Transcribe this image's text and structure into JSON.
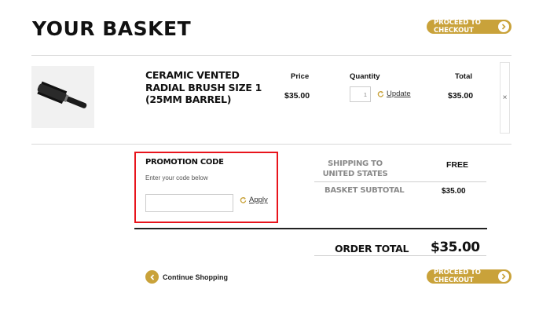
{
  "page": {
    "title": "YOUR BASKET"
  },
  "checkout": {
    "label": "PROCEED TO CHECKOUT"
  },
  "columns": {
    "price": "Price",
    "quantity": "Quantity",
    "total": "Total"
  },
  "item": {
    "name": "CERAMIC VENTED RADIAL BRUSH SIZE 1 (25MM BARREL)",
    "price": "$35.00",
    "quantity": "1",
    "update_label": "Update",
    "total": "$35.00",
    "remove_symbol": "×"
  },
  "promotion": {
    "title": "PROMOTION CODE",
    "hint": "Enter your code below",
    "input_value": "",
    "apply_label": "Apply"
  },
  "summary": {
    "shipping_label": "SHIPPING TO UNITED STATES",
    "shipping_value": "FREE",
    "subtotal_label": "BASKET SUBTOTAL",
    "subtotal_value": "$35.00",
    "order_total_label": "ORDER TOTAL",
    "order_total_value": "$35.00"
  },
  "footer": {
    "continue_label": "Continue Shopping"
  },
  "colors": {
    "accent": "#c9a23a",
    "highlight": "#e8141c"
  }
}
